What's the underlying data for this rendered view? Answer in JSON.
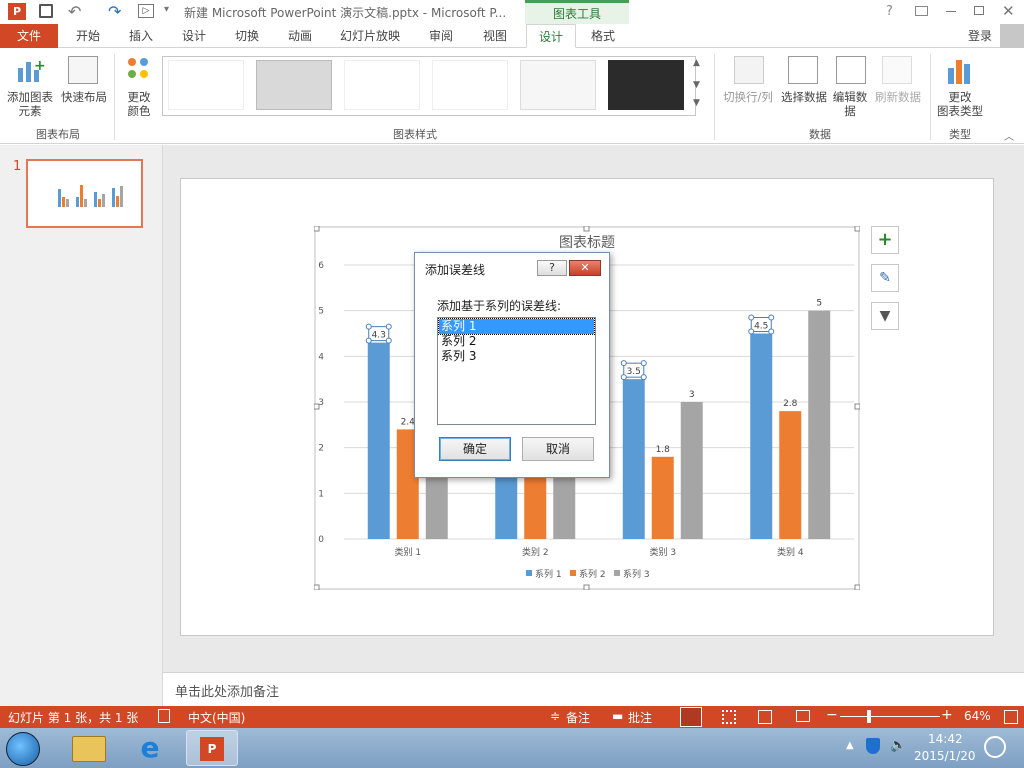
{
  "app": {
    "title": "新建 Microsoft PowerPoint 演示文稿.pptx - Microsoft P...",
    "chart_tools_label": "图表工具",
    "login": "登录"
  },
  "tabs": [
    "文件",
    "开始",
    "插入",
    "设计",
    "切换",
    "动画",
    "幻灯片放映",
    "审阅",
    "视图",
    "设计",
    "格式"
  ],
  "ribbon": {
    "add_element": "添加图表\n元素",
    "quick_layout": "快速布局",
    "change_colors": "更改\n颜色",
    "group_layout": "图表布局",
    "group_styles": "图表样式",
    "switch_rowcol": "切换行/列",
    "select_data": "选择数据",
    "edit_data": "编辑数\n据",
    "refresh_data": "刷新数据",
    "group_data": "数据",
    "change_type": "更改\n图表类型",
    "group_type": "类型"
  },
  "slide_panel": {
    "number": "1"
  },
  "chart_data": {
    "type": "bar",
    "title": "图表标题",
    "categories": [
      "类别 1",
      "类别 2",
      "类别 3",
      "类别 4"
    ],
    "series": [
      {
        "name": "系列 1",
        "values": [
          4.3,
          2.5,
          3.5,
          4.5
        ],
        "color": "#5b9bd5"
      },
      {
        "name": "系列 2",
        "values": [
          2.4,
          4.4,
          1.8,
          2.8
        ],
        "color": "#ed7d31"
      },
      {
        "name": "系列 3",
        "values": [
          2,
          2,
          3,
          5
        ],
        "color": "#a5a5a5"
      }
    ],
    "data_labels": {
      "系列 1": [
        "4.3",
        null,
        "3.5",
        "4.5"
      ],
      "系列 2": [
        "2.4",
        null,
        "1.8",
        "2.8"
      ],
      "系列 3": [
        null,
        null,
        "3",
        "5"
      ]
    },
    "ylim": [
      0,
      6
    ],
    "yticks": [
      "0",
      "1",
      "2",
      "3",
      "4",
      "5",
      "6"
    ],
    "grid": true,
    "legend": "bottom"
  },
  "dialog": {
    "title": "添加误差线",
    "prompt": "添加基于系列的误差线:",
    "items": [
      "系列 1",
      "系列 2",
      "系列 3"
    ],
    "selected": "系列 1",
    "ok": "确定",
    "cancel": "取消"
  },
  "notes": {
    "placeholder": "单击此处添加备注"
  },
  "status": {
    "slide_info": "幻灯片 第 1 张，共 1 张",
    "language": "中文(中国)",
    "notes_btn": "备注",
    "comments_btn": "批注",
    "zoom": "64%"
  },
  "taskbar": {
    "time": "14:42",
    "date": "2015/1/20"
  },
  "colors": {
    "accent": "#d24726",
    "chart_tools": "#2a7a36"
  }
}
